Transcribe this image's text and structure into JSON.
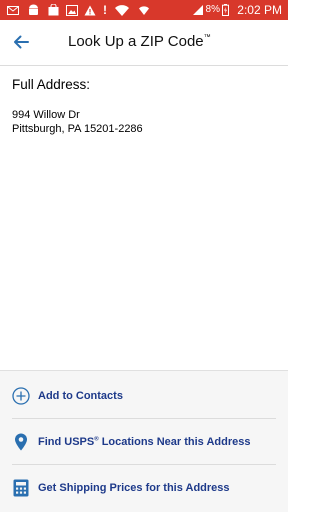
{
  "status_bar": {
    "battery_percent": "8%",
    "time": "2:02 PM",
    "colors": {
      "background": "#d8382b"
    },
    "left_icons": [
      "mail-icon",
      "android-icon",
      "bag-icon",
      "image-icon",
      "warning-icon",
      "exclamation-icon",
      "wifi-icon"
    ],
    "right_icons": [
      "signal-icon",
      "battery-charging-icon"
    ]
  },
  "app_bar": {
    "title": "Look Up a ZIP Code",
    "title_trademark": "™",
    "back_icon": "back-arrow-icon"
  },
  "main": {
    "heading": "Full Address:",
    "address_line1": "994 Willow Dr",
    "address_line2": "Pittsburgh, PA 15201-2286"
  },
  "actions": {
    "add_contacts": {
      "label": "Add to Contacts",
      "icon": "add-circle-icon"
    },
    "find_locations": {
      "label_prefix": "Find USPS",
      "label_reg": "®",
      "label_suffix": " Locations Near this Address",
      "icon": "location-pin-icon"
    },
    "shipping_prices": {
      "label": "Get Shipping Prices for this Address",
      "icon": "calculator-icon"
    },
    "colors": {
      "label": "#1e3a8a",
      "icon": "#2a6fb0"
    }
  }
}
